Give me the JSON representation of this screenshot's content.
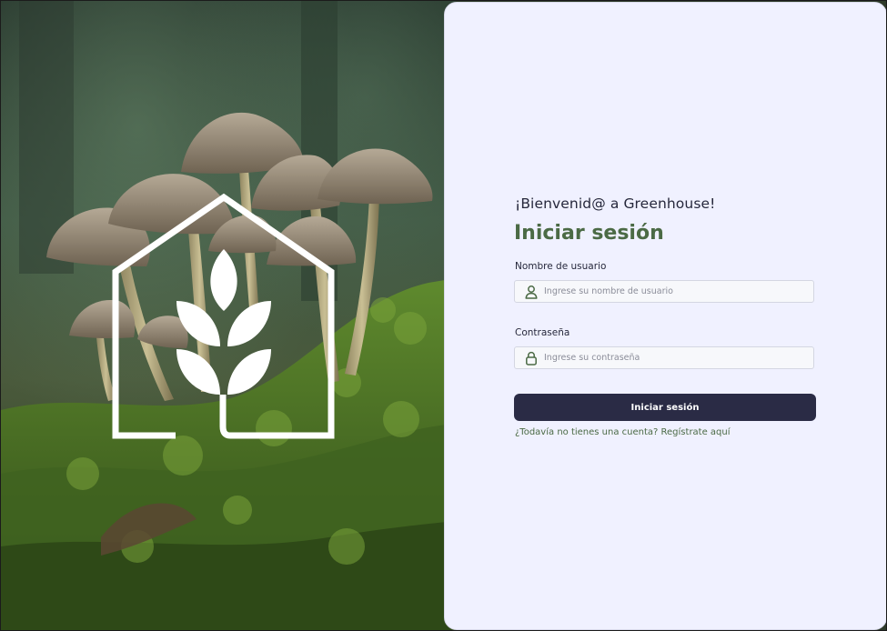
{
  "photo": {
    "logo_icon": "greenhouse-logo-icon"
  },
  "login": {
    "welcome": "¡Bienvenid@ a Greenhouse!",
    "title": "Iniciar sesión",
    "username": {
      "label": "Nombre de usuario",
      "placeholder": "Ingrese su nombre de usuario",
      "value": "",
      "icon": "user-icon"
    },
    "password": {
      "label": "Contraseña",
      "placeholder": "Ingrese su contraseña",
      "value": "",
      "icon": "lock-icon"
    },
    "submit_label": "Iniciar sesión",
    "register_prompt": "¿Todavía no tienes una cuenta?",
    "register_link": "Regístrate aquí"
  },
  "colors": {
    "panel_bg": "#f0f1ff",
    "accent_green": "#4b6a45",
    "button_bg": "#2a2b45",
    "text_dark": "#26283b"
  }
}
